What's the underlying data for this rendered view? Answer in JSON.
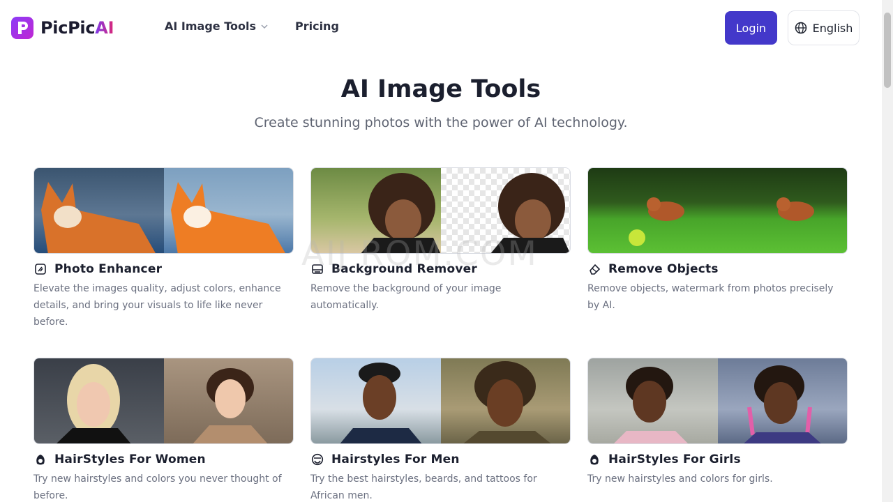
{
  "header": {
    "logo_primary": "PicPic",
    "logo_accent": "AI",
    "nav": [
      {
        "label": "AI Image Tools",
        "icon": "chevron-down-icon"
      },
      {
        "label": "Pricing"
      }
    ],
    "login_label": "Login",
    "language_label": "English",
    "language_icon": "globe-icon"
  },
  "hero": {
    "title": "AI Image Tools",
    "subtitle": "Create stunning photos with the power of AI technology."
  },
  "watermark": "AIJ ROM.COM",
  "cards": [
    {
      "title": "Photo Enhancer",
      "icon": "enhance-icon",
      "description": "Elevate the images quality, adjust colors, enhance details, and bring your visuals to life like never before."
    },
    {
      "title": "Background Remover",
      "icon": "background-remove-icon",
      "description": "Remove the background of your image automatically."
    },
    {
      "title": "Remove Objects",
      "icon": "eraser-icon",
      "description": "Remove objects, watermark from photos precisely by AI."
    },
    {
      "title": "HairStyles For Women",
      "icon": "hair-icon",
      "description": "Try new hairstyles and colors you never thought of before."
    },
    {
      "title": "Hairstyles For Men",
      "icon": "beard-icon",
      "description": "Try the best hairstyles, beards, and tattoos for African men."
    },
    {
      "title": "HairStyles For Girls",
      "icon": "hair-icon",
      "description": "Try new hairstyles and colors for girls."
    }
  ],
  "colors": {
    "primary": "#4338ca",
    "logo_gradient_start": "#7c3aed",
    "logo_gradient_end": "#db2777"
  }
}
